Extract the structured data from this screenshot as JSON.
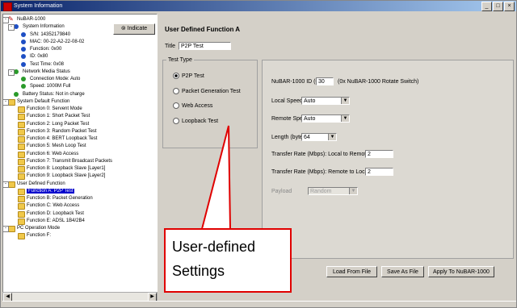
{
  "window": {
    "title": "System Information",
    "buttons": [
      "_",
      "□",
      "×"
    ]
  },
  "tree": {
    "indicate_label": "Indicate",
    "items": [
      {
        "label": "NuBAR-1000",
        "icon": "device-icon"
      },
      {
        "label": "System Information",
        "icon": "info-icon"
      },
      {
        "label": "S/N: 14352179840",
        "icon": "info-icon"
      },
      {
        "label": "MAC: 00-22-A2-22-08-02",
        "icon": "info-icon"
      },
      {
        "label": "Function: 0x00",
        "icon": "info-icon"
      },
      {
        "label": "ID: 0x80",
        "icon": "info-icon"
      },
      {
        "label": "Test Time: 0x08",
        "icon": "info-icon"
      },
      {
        "label": "Network Media Status",
        "icon": "status-icon"
      },
      {
        "label": "Connection Mode: Auto",
        "icon": "status-icon"
      },
      {
        "label": "Speed: 1000M Full",
        "icon": "status-icon"
      },
      {
        "label": "Battery Status: Not in charge",
        "icon": "status-icon"
      },
      {
        "label": "System Default Function",
        "icon": "folder-icon"
      },
      {
        "label": "Function 0: Servent Mode",
        "icon": "folder-icon"
      },
      {
        "label": "Function 1: Short Packet Test",
        "icon": "folder-icon"
      },
      {
        "label": "Function 2: Long Packet Test",
        "icon": "folder-icon"
      },
      {
        "label": "Function 3: Random Packet Test",
        "icon": "folder-icon"
      },
      {
        "label": "Function 4: BERT Loopback Test",
        "icon": "folder-icon"
      },
      {
        "label": "Function 5: Mesh Loop Test",
        "icon": "folder-icon"
      },
      {
        "label": "Function 6: Web Access",
        "icon": "folder-icon"
      },
      {
        "label": "Function 7: Transmit Broadcast Packets",
        "icon": "folder-icon"
      },
      {
        "label": "Function 8: Loopback Slave [Layer1]",
        "icon": "folder-icon"
      },
      {
        "label": "Function 9: Loopback Slave [Layer2]",
        "icon": "folder-icon"
      },
      {
        "label": "User Defined Function",
        "icon": "folder-icon"
      },
      {
        "label": "Function A: P2P Test",
        "icon": "folder-icon"
      },
      {
        "label": "Function B: Packet Generation",
        "icon": "folder-icon"
      },
      {
        "label": "Function C: Web Access",
        "icon": "folder-icon"
      },
      {
        "label": "Function D: Loopback Test",
        "icon": "folder-icon"
      },
      {
        "label": "Function E: ADSL 1B4/2B4",
        "icon": "folder-icon"
      },
      {
        "label": "PC Operation Mode",
        "icon": "folder-icon"
      },
      {
        "label": "Function F:",
        "icon": "folder-icon"
      }
    ],
    "selected_index": 23
  },
  "form": {
    "heading": "User Defined Function A",
    "title_label": "Title",
    "title_value": "P2P Test",
    "test_type_label": "Test Type",
    "test_types": [
      "P2P Test",
      "Packet Generation Test",
      "Web Access",
      "Loopback Test"
    ],
    "test_type_selected": 0,
    "nubar_id_label": "NuBAR-1000 ID (0x)",
    "nubar_id_value": "30",
    "nubar_id_hint": "(0x NuBAR-1000 Rotate Switch)",
    "local_speed_label": "Local Speed",
    "local_speed_value": "Auto",
    "remote_speed_label": "Remote Speed",
    "remote_speed_value": "Auto",
    "length_label": "Length (byte)",
    "length_value": "64",
    "rate_l2r_label": "Transfer Rate (Mbps): Local to Remote",
    "rate_l2r_value": "2",
    "rate_r2l_label": "Transfer Rate (Mbps): Remote to Local",
    "rate_r2l_value": "2",
    "payload_label": "Payload",
    "payload_value": "Random"
  },
  "buttons": {
    "load": "Load From File",
    "save": "Save As File",
    "apply": "Apply To NuBAR-1000"
  },
  "callout": {
    "line1": "User-defined",
    "line2": "Settings",
    "border_color": "#e00000"
  }
}
